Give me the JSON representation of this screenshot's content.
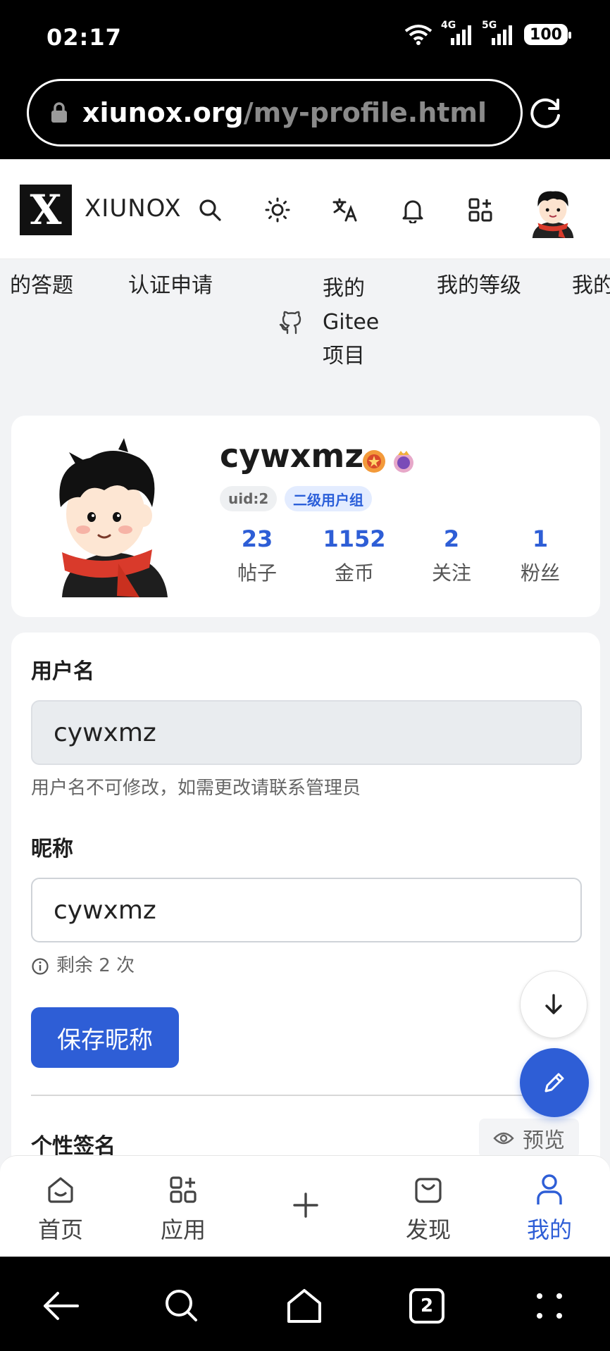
{
  "status_bar": {
    "time": "02:17",
    "net1": "4G",
    "net2": "5G",
    "battery": "100"
  },
  "browser": {
    "url_host": "xiunox.org",
    "url_path": "/my-profile.html"
  },
  "header": {
    "logo_text": "X",
    "brand": "XIUNOX"
  },
  "subnav": {
    "items": [
      "的答题",
      "认证申请",
      "我的",
      "Gitee",
      "项目",
      "我的等级",
      "我的"
    ]
  },
  "profile": {
    "username": "cywxmz",
    "uid_badge": "uid:2",
    "group_badge": "二级用户组",
    "stats": [
      {
        "value": "23",
        "label": "帖子"
      },
      {
        "value": "1152",
        "label": "金币"
      },
      {
        "value": "2",
        "label": "关注"
      },
      {
        "value": "1",
        "label": "粉丝"
      }
    ]
  },
  "form": {
    "username_label": "用户名",
    "username_value": "cywxmz",
    "username_hint": "用户名不可修改，如需更改请联系管理员",
    "nickname_label": "昵称",
    "nickname_value": "cywxmz",
    "remaining_hint": "剩余 2 次",
    "save_button": "保存昵称",
    "signature_label": "个性签名",
    "preview_button": "预览"
  },
  "tabbar": {
    "home": "首页",
    "apps": "应用",
    "discover": "发现",
    "mine": "我的"
  },
  "nav": {
    "tab_count": "2"
  },
  "colors": {
    "accent": "#2e5ed6",
    "background": "#f2f3f5"
  }
}
